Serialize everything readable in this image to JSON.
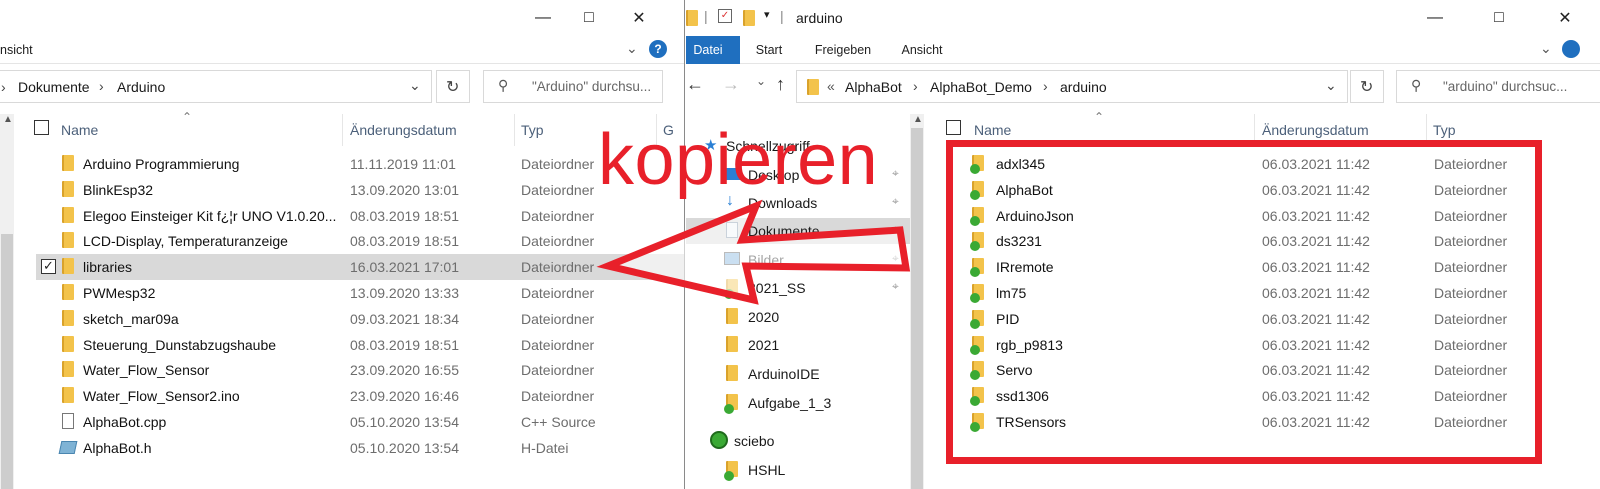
{
  "left": {
    "ribbon_text": "nsicht",
    "help_icon": "?",
    "breadcrumb": [
      "Dokumente",
      "Arduino"
    ],
    "search_placeholder": "\"Arduino\" durchsu...",
    "columns": {
      "name": "Name",
      "date": "Änderungsdatum",
      "type": "Typ",
      "extra": "G"
    },
    "rows": [
      {
        "name": "Arduino Programmierung",
        "date": "11.11.2019 11:01",
        "type": "Dateiordner",
        "icon": "folder-icon"
      },
      {
        "name": "BlinkEsp32",
        "date": "13.09.2020 13:01",
        "type": "Dateiordner",
        "icon": "folder-icon"
      },
      {
        "name": "Elegoo Einsteiger Kit f¿¦r UNO V1.0.20...",
        "date": "08.03.2019 18:51",
        "type": "Dateiordner",
        "icon": "folder-icon"
      },
      {
        "name": "LCD-Display, Temperaturanzeige",
        "date": "08.03.2019 18:51",
        "type": "Dateiordner",
        "icon": "folder-icon"
      },
      {
        "name": "libraries",
        "date": "16.03.2021 17:01",
        "type": "Dateiordner",
        "icon": "folder-icon",
        "selected": true
      },
      {
        "name": "PWMesp32",
        "date": "13.09.2020 13:33",
        "type": "Dateiordner",
        "icon": "folder-icon"
      },
      {
        "name": "sketch_mar09a",
        "date": "09.03.2021 18:34",
        "type": "Dateiordner",
        "icon": "folder-icon"
      },
      {
        "name": "Steuerung_Dunstabzugshaube",
        "date": "08.03.2019 18:51",
        "type": "Dateiordner",
        "icon": "folder-icon"
      },
      {
        "name": "Water_Flow_Sensor",
        "date": "23.09.2020 16:55",
        "type": "Dateiordner",
        "icon": "folder-icon"
      },
      {
        "name": "Water_Flow_Sensor2.ino",
        "date": "23.09.2020 16:46",
        "type": "Dateiordner",
        "icon": "folder-icon"
      },
      {
        "name": "AlphaBot.cpp",
        "date": "05.10.2020 13:54",
        "type": "C++ Source",
        "icon": "cpp-file-icon"
      },
      {
        "name": "AlphaBot.h",
        "date": "05.10.2020 13:54",
        "type": "H-Datei",
        "icon": "header-file-icon"
      }
    ]
  },
  "right": {
    "window_title": "arduino",
    "tabs": [
      "Datei",
      "Start",
      "Freigeben",
      "Ansicht"
    ],
    "breadcrumb": [
      "AlphaBot",
      "AlphaBot_Demo",
      "arduino"
    ],
    "breadcrumb_prefix": "«",
    "search_placeholder": "\"arduino\" durchsuc...",
    "columns": {
      "name": "Name",
      "date": "Änderungsdatum",
      "type": "Typ"
    },
    "nav": [
      {
        "label": "Schnellzugriff",
        "icon": "star-icon",
        "pinned": false
      },
      {
        "label": "Desktop",
        "icon": "desktop-icon",
        "pinned": true
      },
      {
        "label": "Downloads",
        "icon": "download-icon",
        "pinned": true
      },
      {
        "label": "Dokumente",
        "icon": "documents-icon",
        "pinned": true,
        "selected": true
      },
      {
        "label": "Bilder",
        "icon": "pictures-icon",
        "pinned": true
      },
      {
        "label": "2021_SS",
        "icon": "synced-folder-icon",
        "pinned": true
      },
      {
        "label": "2020",
        "icon": "folder-icon",
        "pinned": false
      },
      {
        "label": "2021",
        "icon": "folder-icon",
        "pinned": false
      },
      {
        "label": "ArduinoIDE",
        "icon": "folder-icon",
        "pinned": false
      },
      {
        "label": "Aufgabe_1_3",
        "icon": "synced-folder-icon",
        "pinned": false
      },
      {
        "label": "sciebo",
        "icon": "sciebo-icon",
        "pinned": false
      },
      {
        "label": "HSHL",
        "icon": "synced-folder-icon",
        "pinned": false
      }
    ],
    "rows": [
      {
        "name": "adxl345",
        "date": "06.03.2021 11:42",
        "type": "Dateiordner"
      },
      {
        "name": "AlphaBot",
        "date": "06.03.2021 11:42",
        "type": "Dateiordner"
      },
      {
        "name": "ArduinoJson",
        "date": "06.03.2021 11:42",
        "type": "Dateiordner"
      },
      {
        "name": "ds3231",
        "date": "06.03.2021 11:42",
        "type": "Dateiordner"
      },
      {
        "name": "IRremote",
        "date": "06.03.2021 11:42",
        "type": "Dateiordner"
      },
      {
        "name": "lm75",
        "date": "06.03.2021 11:42",
        "type": "Dateiordner"
      },
      {
        "name": "PID",
        "date": "06.03.2021 11:42",
        "type": "Dateiordner"
      },
      {
        "name": "rgb_p9813",
        "date": "06.03.2021 11:42",
        "type": "Dateiordner"
      },
      {
        "name": "Servo",
        "date": "06.03.2021 11:42",
        "type": "Dateiordner"
      },
      {
        "name": "ssd1306",
        "date": "06.03.2021 11:42",
        "type": "Dateiordner"
      },
      {
        "name": "TRSensors",
        "date": "06.03.2021 11:42",
        "type": "Dateiordner"
      }
    ]
  },
  "annotation": {
    "text": "kopieren",
    "color": "#e8202a"
  },
  "colors": {
    "accent": "#1f6fbf",
    "folder": "#f3c34b",
    "selection": "#d9d9d9",
    "sync_ok": "#3aa934"
  }
}
